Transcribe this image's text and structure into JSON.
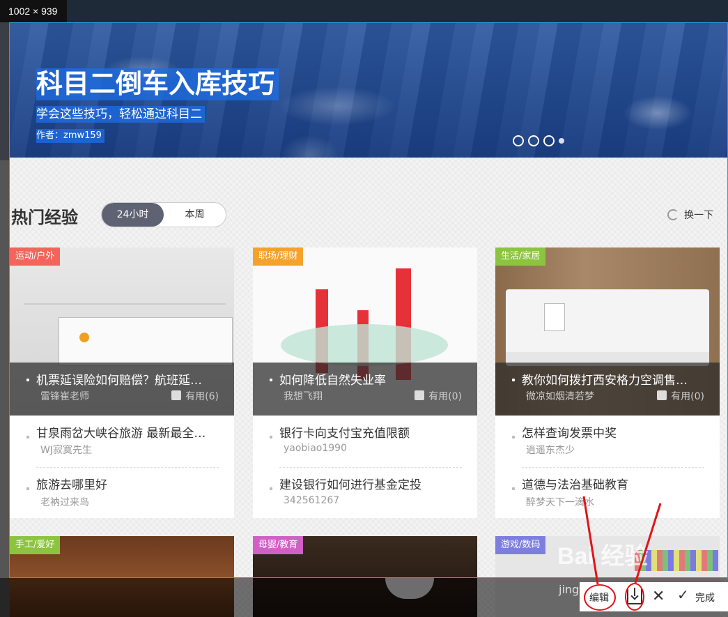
{
  "screenshot_size_label": "1002 × 939",
  "banner": {
    "title": "科目二倒车入库技巧",
    "subtitle": "学会这些技巧，轻松通过科目二",
    "author": "作者：zmw159"
  },
  "section": {
    "title": "热门经验",
    "tabs": [
      "24小时",
      "本周"
    ],
    "active_tab": "24小时",
    "refresh_label": "换一下"
  },
  "cards": [
    {
      "tag": "运动/户外",
      "tag_color": "#f2645c",
      "featured_title": "机票延误险如何赔偿？航班延…",
      "featured_author": "雷锋崔老师",
      "featured_useful": "有用(6)",
      "items": [
        {
          "title": "甘泉雨岔大峡谷旅游 最新最全…",
          "author": "WJ寂寞先生"
        },
        {
          "title": "旅游去哪里好",
          "author": "老衲过来鸟"
        }
      ]
    },
    {
      "tag": "职场/理财",
      "tag_color": "#f4a22b",
      "featured_title": "如何降低自然失业率",
      "featured_author": "我想飞翔",
      "featured_useful": "有用(0)",
      "items": [
        {
          "title": "银行卡向支付宝充值限额",
          "author": "yaobiao1990"
        },
        {
          "title": "建设银行如何进行基金定投",
          "author": "342561267"
        }
      ]
    },
    {
      "tag": "生活/家居",
      "tag_color": "#8dc43f",
      "featured_title": "教你如何拨打西安格力空调售…",
      "featured_author": "微凉如烟清若梦",
      "featured_useful": "有用(0)",
      "items": [
        {
          "title": "怎样查询发票中奖",
          "author": "逍遥东杰少"
        },
        {
          "title": "道德与法治基础教育",
          "author": "醉梦天下一滴水"
        }
      ]
    }
  ],
  "bottom_cards": [
    {
      "tag": "手工/爱好",
      "tag_color": "#8dc43f"
    },
    {
      "tag": "母婴/教育",
      "tag_color": "#d160c6"
    },
    {
      "tag": "游戏/数码",
      "tag_color": "#7e7ee0"
    }
  ],
  "toolbar": {
    "edit_label": "编辑",
    "download_icon": "download-icon",
    "close_icon": "close-icon",
    "done_label": "完成"
  },
  "watermark": {
    "main": "Bai 经验",
    "sub": "jingyan.baidu.com"
  }
}
